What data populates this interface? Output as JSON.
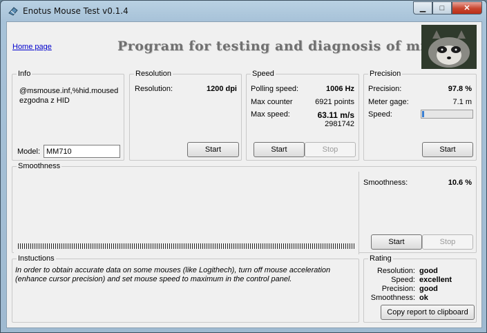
{
  "window": {
    "title": "Enotus Mouse Test v0.1.4",
    "minimize": "▁",
    "maximize": "□",
    "close": "✕"
  },
  "header": {
    "home_link": "Home page",
    "heading": "Program for testing and diagnosis of mice"
  },
  "info": {
    "legend": "Info",
    "device": "@msmouse.inf,%hid.mousedezgodna z HID",
    "model_label": "Model:",
    "model_value": "MM710"
  },
  "resolution": {
    "legend": "Resolution",
    "label": "Resolution:",
    "value": "1200 dpi",
    "start": "Start"
  },
  "speed": {
    "legend": "Speed",
    "polling_label": "Polling speed:",
    "polling_value": "1006 Hz",
    "counter_label": "Max counter",
    "counter_value": "6921 points",
    "max_label": "Max  speed:",
    "max_value": "63.11 m/s",
    "max_sub": "2981742",
    "start": "Start",
    "stop": "Stop"
  },
  "precision": {
    "legend": "Precision",
    "precision_label": "Precision:",
    "precision_value": "97.8 %",
    "gage_label": "Meter gage:",
    "gage_value": "7.1 m",
    "speed_label": "Speed:",
    "speed_progress": 0.04,
    "start": "Start"
  },
  "smoothness": {
    "legend": "Smoothness",
    "label": "Smoothness:",
    "value": "10.6 %",
    "start": "Start",
    "stop": "Stop"
  },
  "instructions": {
    "legend": "Instuctions",
    "text": "In order to obtain accurate data on some mouses (like Logithech), turn off mouse acceleration (enhance cursor precision) and set mouse speed to maximum in the control panel."
  },
  "rating": {
    "legend": "Rating",
    "rows": [
      {
        "key": "Resolution:",
        "value": "good"
      },
      {
        "key": "Speed:",
        "value": "excellent"
      },
      {
        "key": "Precision:",
        "value": "good"
      },
      {
        "key": "Smoothness:",
        "value": "ok"
      }
    ],
    "copy": "Copy report to clipboard"
  },
  "colors": {
    "accent": "#3a7fd2",
    "link": "#0000cc",
    "close": "#c8452f"
  },
  "icons": {
    "app": "mouse-icon",
    "photo": "raccoon-image"
  }
}
